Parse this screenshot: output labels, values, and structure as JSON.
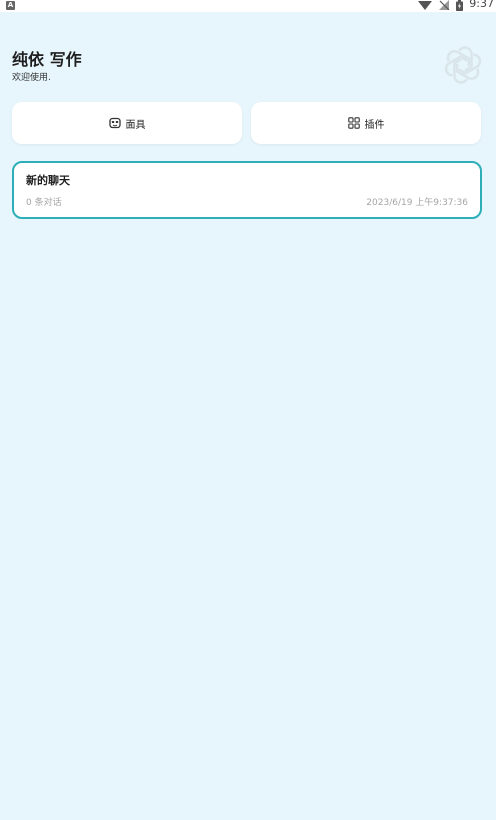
{
  "status_bar": {
    "notification_icon": "a-icon",
    "notification_glyph": "A",
    "time": "9:37"
  },
  "header": {
    "title": "纯依 写作",
    "subtitle": "欢迎使用.",
    "logo_icon": "openai-logo-icon"
  },
  "actions": {
    "masks_label": "面具",
    "masks_icon": "mask-icon",
    "plugins_label": "插件",
    "plugins_icon": "grid-icon"
  },
  "chats": [
    {
      "title": "新的聊天",
      "count": "0 条对话",
      "time": "2023/6/19 上午9:37:36"
    }
  ],
  "colors": {
    "background": "#e7f6fc",
    "card": "#ffffff",
    "accent_border": "#2eaeb8",
    "muted_text": "#a5a5a5"
  }
}
